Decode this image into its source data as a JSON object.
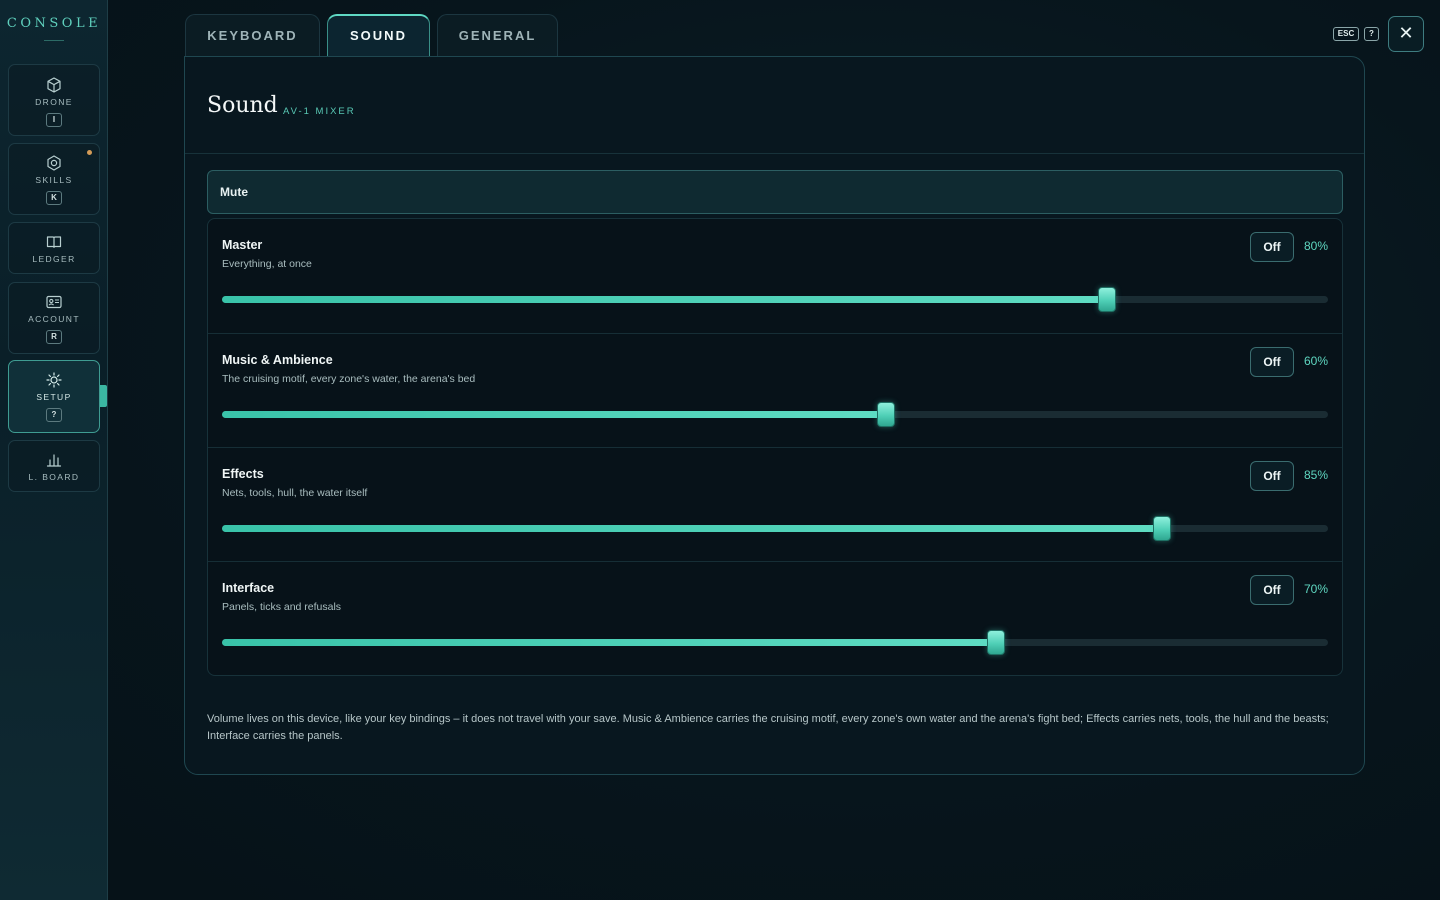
{
  "sidebar": {
    "brand": "CONSOLE",
    "items": [
      {
        "label": "DRONE",
        "key": "I",
        "icon": "cube-icon"
      },
      {
        "label": "SKILLS",
        "key": "K",
        "icon": "hexagon-icon",
        "notification": true
      },
      {
        "label": "LEDGER",
        "key": "",
        "icon": "book-icon"
      },
      {
        "label": "ACCOUNT",
        "key": "R",
        "icon": "id-card-icon"
      },
      {
        "label": "SETUP",
        "key": "?",
        "icon": "sun-gear-icon",
        "active": true
      },
      {
        "label": "L. BOARD",
        "key": "",
        "icon": "bar-chart-icon"
      }
    ]
  },
  "tabs": [
    {
      "label": "KEYBOARD"
    },
    {
      "label": "SOUND",
      "active": true
    },
    {
      "label": "GENERAL"
    }
  ],
  "top_right": {
    "esc_key": "ESC",
    "help_key": "?",
    "close_icon": "close-icon"
  },
  "panel": {
    "title": "Sound",
    "subtitle": "AV-1 MIXER",
    "mute_label": "Mute",
    "channels": [
      {
        "name": "Master",
        "description": "Everything, at once",
        "off_label": "Off",
        "percent_text": "80%",
        "value": 80
      },
      {
        "name": "Music & Ambience",
        "description": "The cruising motif, every zone's water, the arena's bed",
        "off_label": "Off",
        "percent_text": "60%",
        "value": 60
      },
      {
        "name": "Effects",
        "description": "Nets, tools, hull, the water itself",
        "off_label": "Off",
        "percent_text": "85%",
        "value": 85
      },
      {
        "name": "Interface",
        "description": "Panels, ticks and refusals",
        "off_label": "Off",
        "percent_text": "70%",
        "value": 70
      }
    ],
    "footnote": "Volume lives on this device, like your key bindings – it does not travel with your save. Music & Ambience carries the cruising motif, every zone's own water and the arena's fight bed; Effects carries nets, tools, the hull and the beasts; Interface carries the panels."
  },
  "colors": {
    "accent": "#5fd7c1",
    "notification": "#d39b57",
    "background": "#07151c"
  }
}
